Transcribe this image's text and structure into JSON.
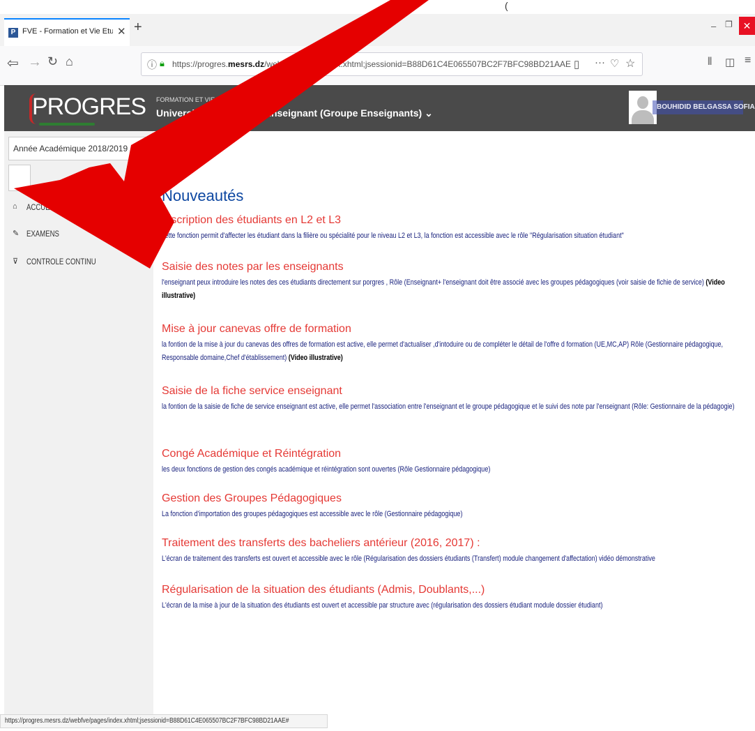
{
  "browser": {
    "tab_title": "FVE - Formation et Vie Etudiant",
    "tab_favicon": "P",
    "close_glyph": "✕",
    "newtab_glyph": "+",
    "url_prefix": "https://progres.",
    "url_domain": "mesrs.dz",
    "url_rest": "/webfve/pages/index.xhtml;jsessionid=B88D61C4E065507BC2F7BFC98BD21AAE",
    "status_url": "https://progres.mesrs.dz/webfve/pages/index.xhtml;jsessionid=B88D61C4E065507BC2F7BFC98BD21AAE#",
    "icons": [
      "back-icon",
      "forward-icon",
      "reload-icon",
      "home-icon",
      "info-icon",
      "lock-icon",
      "reader-icon",
      "more-icon",
      "pocket-icon",
      "bookmark-star-icon",
      "library-icon",
      "sidebar-icon",
      "menu-icon"
    ]
  },
  "header": {
    "logo": "PROGRES",
    "small_title": "FORMATION ET VIE ETUDIANTE",
    "university": "Université de Guelma - Enseignant (Groupe Enseignants) ⌄",
    "user_name": "BOUHIDID BELGASSA SOFIANE"
  },
  "sidebar": {
    "year": "Année Académique 2018/2019",
    "menu": [
      {
        "label": "ACCUEIL",
        "icon": "home-icon",
        "glyph": "⌂"
      },
      {
        "label": "EXAMENS",
        "icon": "pencil-icon",
        "glyph": "✎"
      },
      {
        "label": "CONTROLE CONTINU",
        "icon": "filter-icon",
        "glyph": "⊽"
      }
    ]
  },
  "main": {
    "title": "Nouveautés",
    "news": [
      {
        "title": "Inscription des étudiants en L2 et L3",
        "body": "cette fonction permit d'affecter les étudiant dans la filière ou spécialité pour le niveau L2 et L3, la fonction est accessible avec le rôle \"Régularisation situation étudiant\""
      },
      {
        "title": "Saisie des notes par les enseignants",
        "body": "l'enseignant peux introduire les notes des ces étudiants directement sur porgres , Rôle (Enseignant+ l'enseignant doit être associé avec les groupes pédagogiques (voir saisie de fichie de service)",
        "link": "(Video illustrative)"
      },
      {
        "title": "Mise à jour canevas offre de formation",
        "body": "la fontion de la mise à jour du canevas des offres de formation est active, elle permet d'actualiser ,d'intoduire ou de compléter le détail de l'offre d formation (UE,MC,AP) Rôle (Gestionnaire pédagogique, Responsable domaine,Chef d'établissement)",
        "link": "(Video illustrative)"
      },
      {
        "title": "Saisie de la fiche service enseignant",
        "body": "la fontion de la saisie de fiche de service enseignant est active, elle permet l'association entre l'enseignant et le groupe pédagogique et le suivi des note par l'enseignant (Rôle: Gestionnaire de la pédagogie)"
      },
      {
        "title": "Congé Académique et Réintégration",
        "body": "les deux fonctions de gestion des congés académique et réintégration sont ouvertes (Rôle Gestionnaire pédagogique)"
      },
      {
        "title": "Gestion des Groupes Pédagogiques",
        "body": "La fonction d'importation des groupes pédagogiques est accessible avec le rôle (Gestionnaire pédagogique)"
      },
      {
        "title": "Traitement des transferts des bacheliers antérieur (2016, 2017) :",
        "body": "L'écran de traitement des transferts est ouvert et accessible avec le rôle (Régularisation des dossiers étudiants (Transfert) module changement d'affectation) vidéo démonstrative"
      },
      {
        "title": "Régularisation de la situation des étudiants (Admis, Doublants,...)",
        "body": "L'écran de la mise à jour de la situation des étudiants est ouvert et accessible par structure avec (régularisation des dossiers étudiant module dossier étudiant)"
      }
    ]
  },
  "colors": {
    "news_title": "#e53935",
    "news_body": "#1a237e",
    "header_bg": "#4a4a4a",
    "arrow": "#e50000"
  }
}
